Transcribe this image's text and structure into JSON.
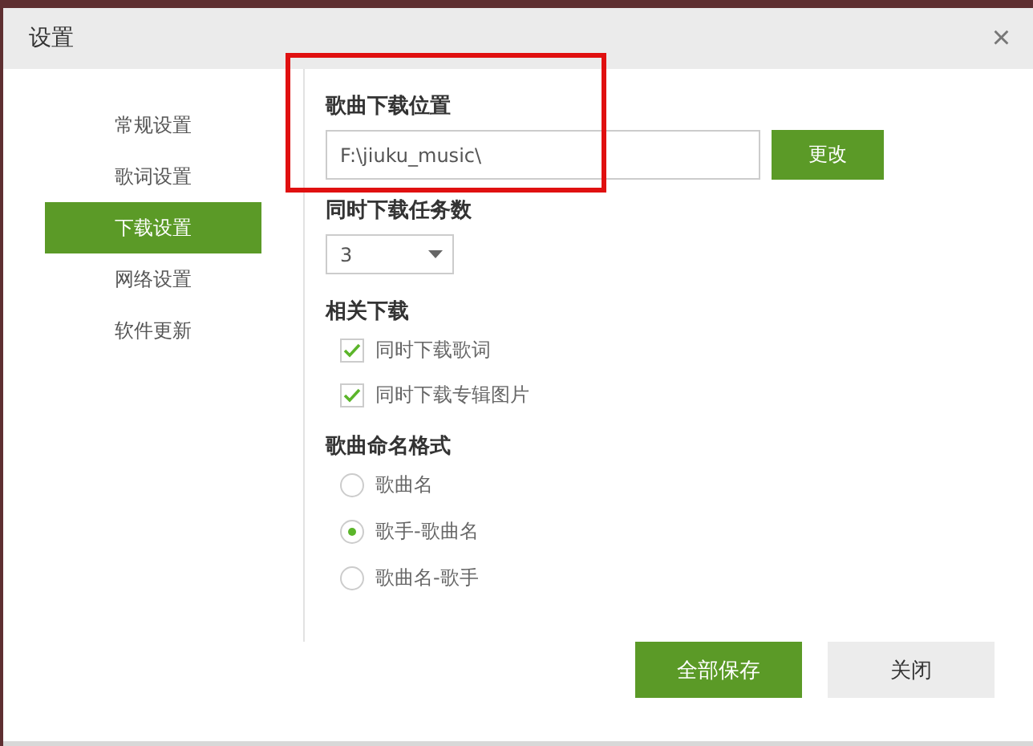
{
  "window": {
    "title": "设置",
    "close": "×"
  },
  "sidebar": {
    "items": [
      {
        "label": "常规设置",
        "selected": false
      },
      {
        "label": "歌词设置",
        "selected": false
      },
      {
        "label": "下载设置",
        "selected": true
      },
      {
        "label": "网络设置",
        "selected": false
      },
      {
        "label": "软件更新",
        "selected": false
      }
    ]
  },
  "download_location": {
    "heading": "歌曲下载位置",
    "value": "F:\\jiuku_music\\",
    "button": "更改"
  },
  "concurrent_tasks": {
    "heading": "同时下载任务数",
    "value": "3"
  },
  "related_downloads": {
    "heading": "相关下载",
    "options": [
      {
        "label": "同时下载歌词",
        "checked": true
      },
      {
        "label": "同时下载专辑图片",
        "checked": true
      }
    ]
  },
  "naming_format": {
    "heading": "歌曲命名格式",
    "options": [
      {
        "label": "歌曲名",
        "selected": false
      },
      {
        "label": "歌手-歌曲名",
        "selected": true
      },
      {
        "label": "歌曲名-歌手",
        "selected": false
      }
    ]
  },
  "buttons": [
    {
      "label": "全部保存",
      "kind": "primary"
    },
    {
      "label": "关闭",
      "kind": "secondary"
    }
  ]
}
